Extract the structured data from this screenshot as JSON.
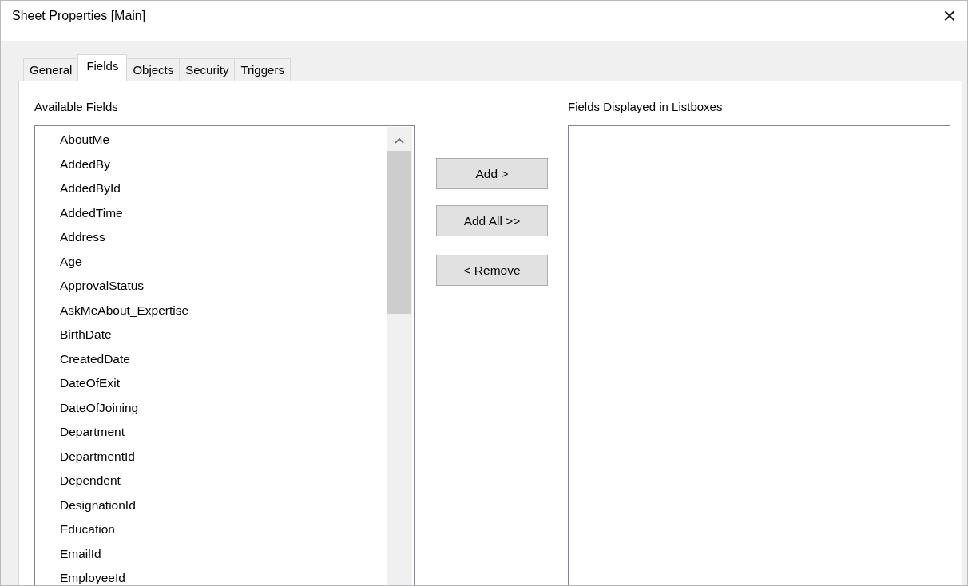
{
  "window": {
    "title": "Sheet Properties [Main]",
    "close": "×"
  },
  "tabs": [
    {
      "label": "General",
      "selected": false
    },
    {
      "label": "Fields",
      "selected": true
    },
    {
      "label": "Objects",
      "selected": false
    },
    {
      "label": "Security",
      "selected": false
    },
    {
      "label": "Triggers",
      "selected": false
    }
  ],
  "available_fields": {
    "label": "Available Fields",
    "items": [
      "AboutMe",
      "AddedBy",
      "AddedById",
      "AddedTime",
      "Address",
      "Age",
      "ApprovalStatus",
      "AskMeAbout_Expertise",
      "BirthDate",
      "CreatedDate",
      "DateOfExit",
      "DateOfJoining",
      "Department",
      "DepartmentId",
      "Dependent",
      "DesignationId",
      "Education",
      "EmailId",
      "EmployeeId"
    ]
  },
  "buttons": [
    "Add >",
    "Add All >>",
    "< Remove"
  ],
  "displayed_fields": {
    "label": "Fields Displayed in Listboxes"
  }
}
